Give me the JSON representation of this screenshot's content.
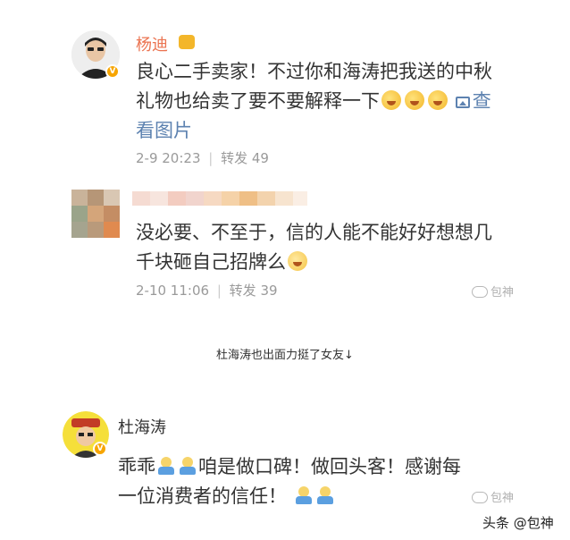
{
  "post1": {
    "name": "杨迪",
    "text_line1": "良心二手卖家！不过你和海涛把我送的中秋",
    "text_line2": "礼物也给卖了要不要解释一下",
    "link_part1": "查",
    "link_part2": "看图片",
    "emoji": "laugh-cry-emoji",
    "timestamp": "2-9 20:23",
    "reposts": "转发 49"
  },
  "reply": {
    "text_line1": "没必要、不至于，信的人能不能好好想想几",
    "text_line2": "千块砸自己招牌么",
    "timestamp": "2-10 11:06",
    "reposts": "转发 39",
    "watermark": "包神"
  },
  "caption": "杜海涛也出面力挺了女友↓",
  "post2": {
    "name": "杜海涛",
    "text_start": "乖乖",
    "text_mid": "咱是做口碑！做回头客！感谢每",
    "text_line2": "一位消费者的信任！",
    "watermark": "包神"
  },
  "footer": "头条 @包神",
  "colors": {
    "name": "#eb7350",
    "link": "#5d82b0",
    "meta": "#9a9a9a",
    "badge": "#f7a500"
  }
}
